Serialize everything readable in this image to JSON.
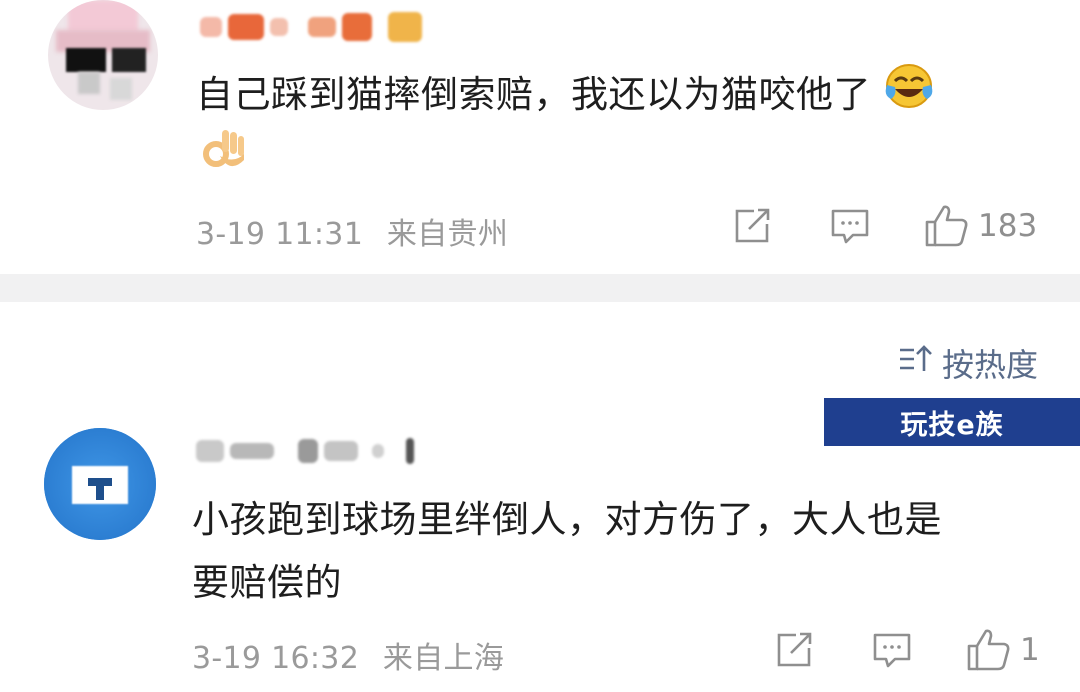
{
  "comments": [
    {
      "text_line1": "自己踩到猫摔倒索赔，我还以为猫咬他了",
      "date": "3-19 11:31",
      "location": "来自贵州",
      "like_count": "183"
    },
    {
      "text_line1": "小孩跑到球场里绊倒人，对方伤了，大人也是",
      "text_line2": "要赔偿的",
      "date": "3-19 16:32",
      "location": "来自上海",
      "like_count": "1"
    }
  ],
  "sort": {
    "label": "按热度",
    "icon": "sort-icon"
  },
  "watermark": {
    "text": "玩技e族"
  },
  "icons": {
    "share": "share-icon",
    "reply": "comment-icon",
    "like": "thumbs-up-icon",
    "laugh": "crying-laughing-emoji",
    "ok": "ok-hand-emoji"
  },
  "colors": {
    "text": "#1e1e1e",
    "meta": "#9a9a9a",
    "sort": "#5a6c8a",
    "divider": "#f1f1f2",
    "watermark_bg": "#1f3f8f"
  }
}
